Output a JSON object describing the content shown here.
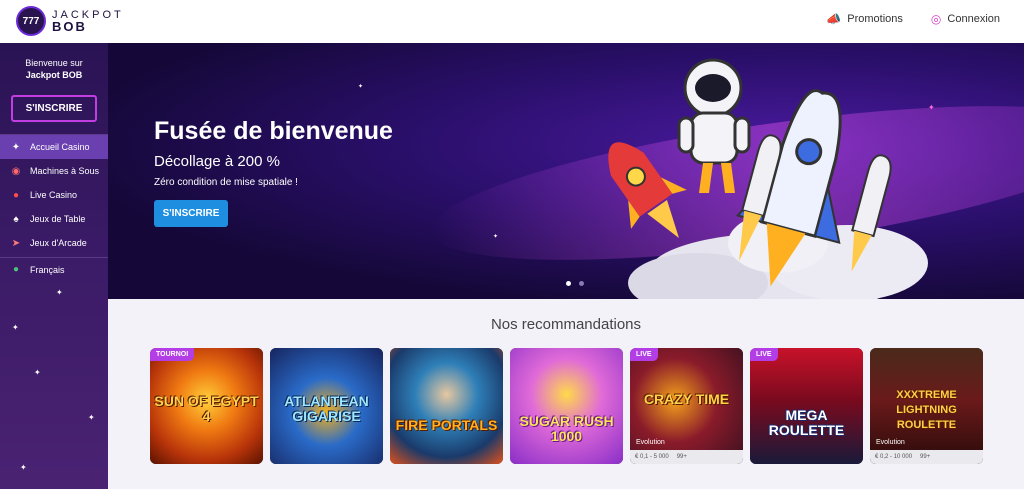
{
  "header": {
    "logo_line1": "JACKPOT",
    "logo_line2": "BOB",
    "logo_badge": "777",
    "promotions_label": "Promotions",
    "connexion_label": "Connexion"
  },
  "sidebar": {
    "welcome_line1": "Bienvenue sur",
    "welcome_line2": "Jackpot BOB",
    "signup_label": "S'INSCRIRE",
    "items": [
      {
        "label": "Accueil Casino",
        "icon": "rocket-icon",
        "active": true
      },
      {
        "label": "Machines à Sous",
        "icon": "slot-machine-icon",
        "active": false
      },
      {
        "label": "Live Casino",
        "icon": "live-dealer-icon",
        "active": false
      },
      {
        "label": "Jeux de Table",
        "icon": "cards-icon",
        "active": false
      },
      {
        "label": "Jeux d'Arcade",
        "icon": "arcade-rocket-icon",
        "active": false
      }
    ],
    "language_label": "Français"
  },
  "hero": {
    "title": "Fusée de bienvenue",
    "subtitle": "Décollage à 200 %",
    "note": "Zéro condition de mise spatiale !",
    "button_label": "S'INSCRIRE"
  },
  "recommendations": {
    "title": "Nos recommandations",
    "cards": [
      {
        "name": "SUN OF EGYPT 4",
        "badge": "TOURNOI",
        "info": "",
        "provider": ""
      },
      {
        "name": "ATLANTEAN GIGARISE",
        "badge": "",
        "info": "",
        "provider": ""
      },
      {
        "name": "FIRE PORTALS",
        "badge": "",
        "info": "",
        "provider": ""
      },
      {
        "name": "SUGAR RUSH 1000",
        "badge": "",
        "info": "",
        "provider": ""
      },
      {
        "name": "CRAZY TIME",
        "badge": "LIVE",
        "bet": "€ 0,1 - 5 000",
        "players": "99+",
        "provider": "Evolution"
      },
      {
        "name": "MEGA ROULETTE",
        "badge": "LIVE",
        "bet": "",
        "players": "",
        "provider": ""
      },
      {
        "name": "XXXTREME LIGHTNING ROULETTE",
        "badge": "",
        "bet": "€ 0,2 - 10 000",
        "players": "99+",
        "provider": "Evolution"
      }
    ]
  }
}
